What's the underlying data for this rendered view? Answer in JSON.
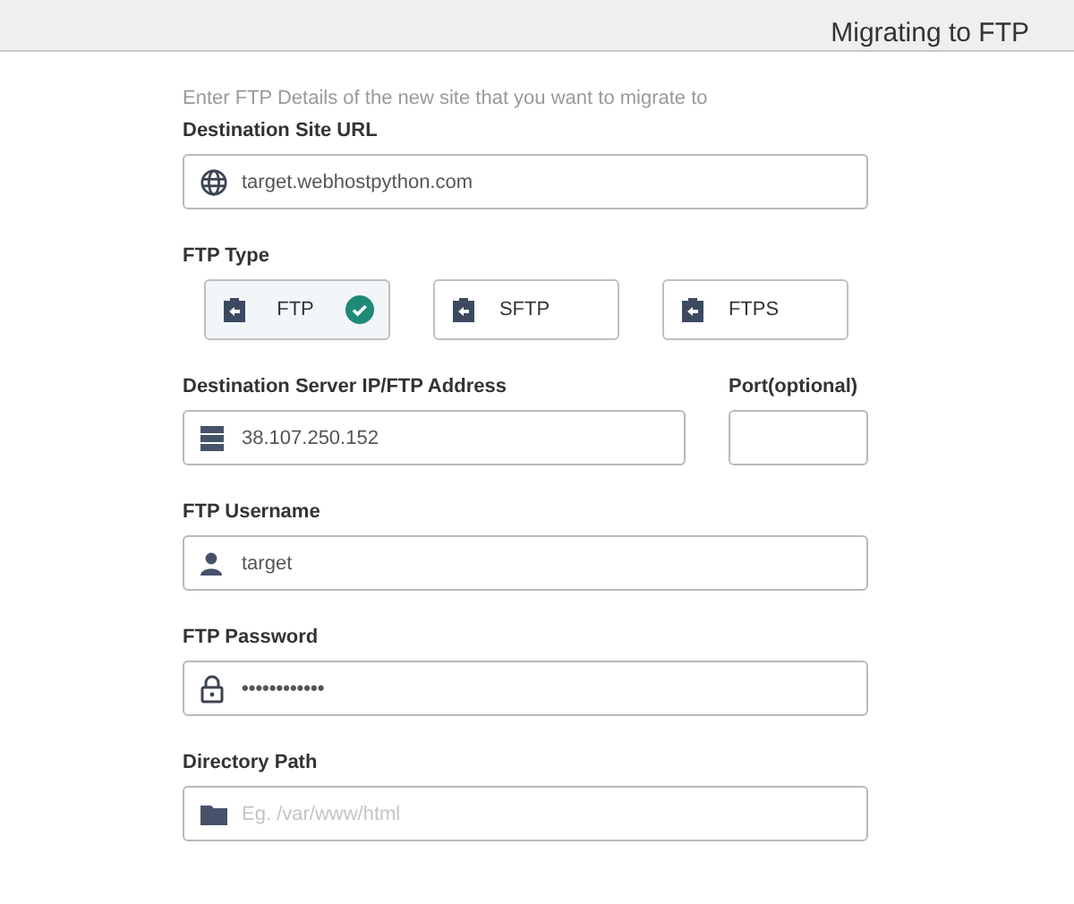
{
  "header": {
    "title": "Migrating to FTP"
  },
  "intro": "Enter FTP Details of the new site that you want to migrate to",
  "destination_site_url": {
    "label": "Destination Site URL",
    "value": "target.webhostpython.com"
  },
  "ftp_type": {
    "label": "FTP Type",
    "options": [
      {
        "label": "FTP",
        "selected": true
      },
      {
        "label": "SFTP",
        "selected": false
      },
      {
        "label": "FTPS",
        "selected": false
      }
    ]
  },
  "server_address": {
    "label": "Destination Server IP/FTP Address",
    "value": "38.107.250.152"
  },
  "port": {
    "label": "Port(optional)"
  },
  "ftp_username": {
    "label": "FTP Username",
    "value": "target"
  },
  "ftp_password": {
    "label": "FTP Password",
    "value": "••••••••••••"
  },
  "directory_path": {
    "label": "Directory Path",
    "placeholder": "Eg. /var/www/html"
  }
}
